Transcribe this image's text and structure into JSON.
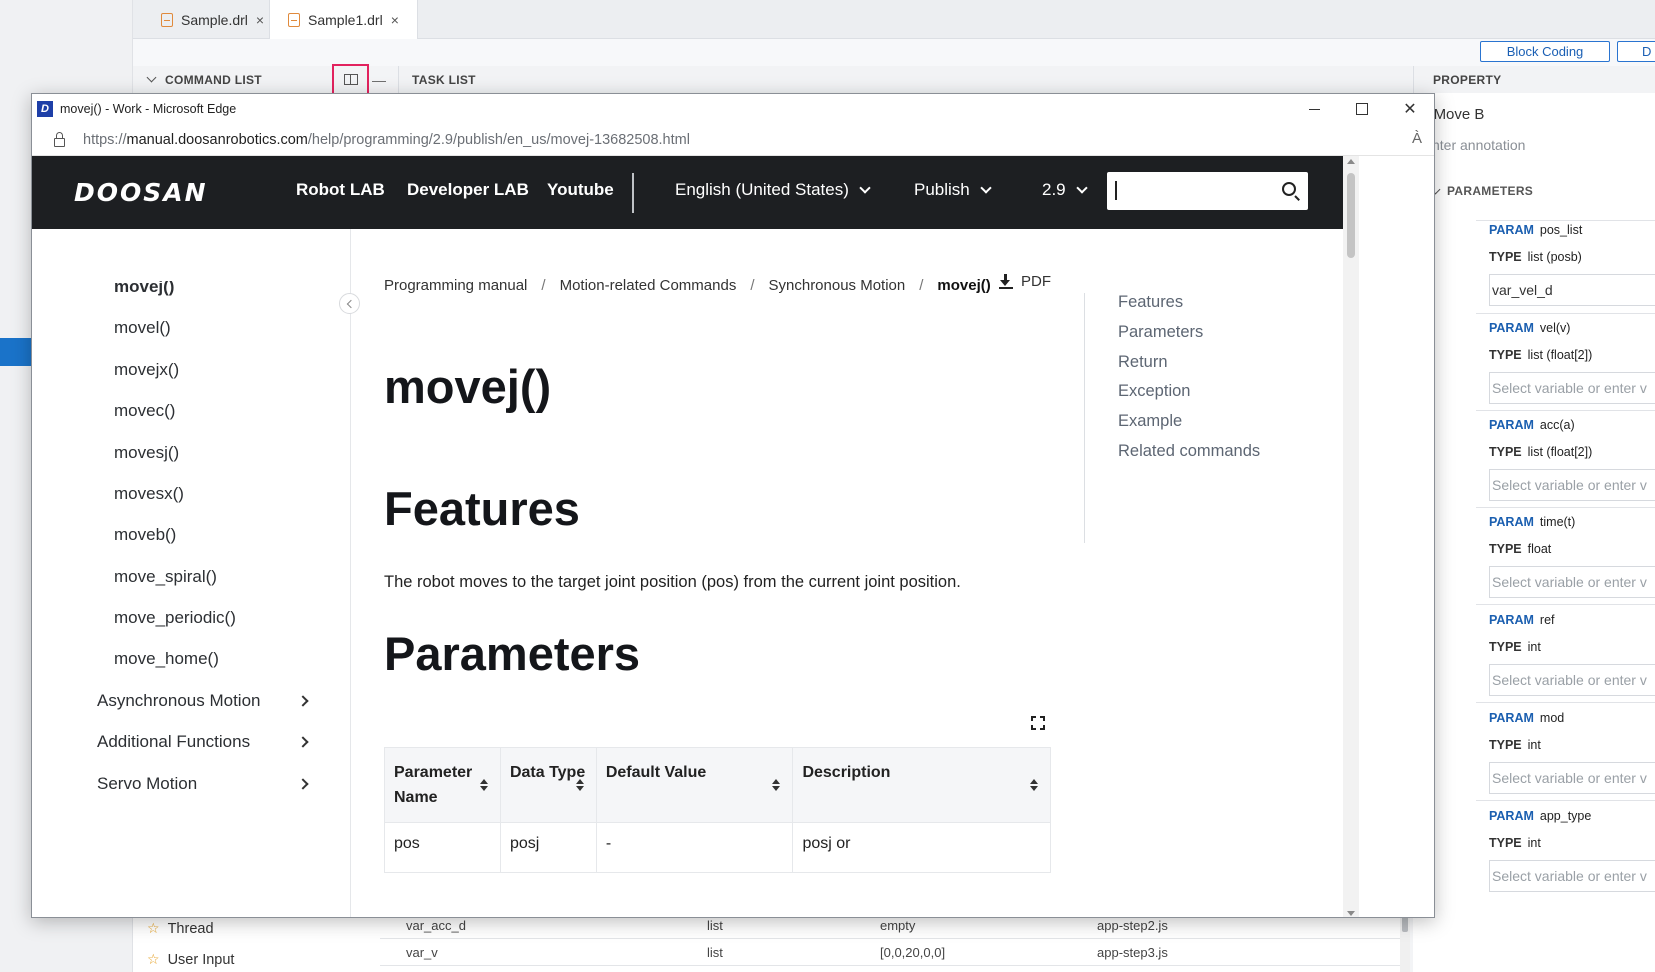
{
  "ide": {
    "tabs": [
      {
        "label": "Sample.drl",
        "close": "×"
      },
      {
        "label": "Sample1.drl",
        "close": "×"
      }
    ],
    "mode_buttons": [
      "Block Coding",
      "D"
    ],
    "command_list_label": "COMMAND LIST",
    "task_list_label": "TASK LIST",
    "property_label": "PROPERTY",
    "property_title": "Move B",
    "annotation_placeholder": "nter annotation",
    "parameters_label": "PARAMETERS",
    "param_keyword": "PARAM",
    "type_keyword": "TYPE",
    "params": [
      {
        "name": "pos_list",
        "type": "list (posb)",
        "value": "var_vel_d",
        "filled": true
      },
      {
        "name": "vel(v)",
        "type": "list (float[2])",
        "value": "Select variable or enter v"
      },
      {
        "name": "acc(a)",
        "type": "list (float[2])",
        "value": "Select variable or enter v"
      },
      {
        "name": "time(t)",
        "type": "float",
        "value": "Select variable or enter v"
      },
      {
        "name": "ref",
        "type": "int",
        "value": "Select variable or enter v"
      },
      {
        "name": "mod",
        "type": "int",
        "value": "Select variable or enter v"
      },
      {
        "name": "app_type",
        "type": "int",
        "value": "Select variable or enter v"
      }
    ],
    "commands": [
      "Thread",
      "User Input"
    ],
    "variables": [
      {
        "name": "var_acc_d",
        "type": "list",
        "value": "empty",
        "source": "app-step2.js"
      },
      {
        "name": "var_v",
        "type": "list",
        "value": "[0,0,20,0,0]",
        "source": "app-step3.js"
      }
    ]
  },
  "browser": {
    "window_title": "movej() - Work - Microsoft Edge",
    "url_prefix": "https://",
    "url_domain": "manual.doosanrobotics.com",
    "url_path": "/help/programming/2.9/publish/en_us/movej-13682508.html",
    "controls": {
      "close": "✕",
      "read_aloud": "À"
    }
  },
  "site": {
    "logo": "DOOSAN",
    "nav": [
      "Robot LAB",
      "Developer LAB",
      "Youtube"
    ],
    "language": "English (United States)",
    "publish": "Publish",
    "version": "2.9",
    "sidebar": {
      "items": [
        "movej()",
        "movel()",
        "movejx()",
        "movec()",
        "movesj()",
        "movesx()",
        "moveb()",
        "move_spiral()",
        "move_periodic()",
        "move_home()"
      ],
      "groups": [
        "Asynchronous Motion",
        "Additional Functions",
        "Servo Motion"
      ]
    },
    "breadcrumb": [
      "Programming manual",
      "Motion-related Commands",
      "Synchronous Motion",
      "movej()"
    ],
    "breadcrumb_sep": "/",
    "pdf_label": "PDF",
    "page_title": "movej()",
    "sections": {
      "features": "Features",
      "parameters": "Parameters"
    },
    "features_text": "The robot moves to the target joint position (pos) from the current joint position.",
    "table": {
      "headers": [
        "Parameter Name",
        "Data Type",
        "Default Value",
        "Description"
      ],
      "rows": [
        [
          "pos",
          "posj",
          "-",
          "posj or"
        ]
      ]
    },
    "toc": [
      "Features",
      "Parameters",
      "Return",
      "Exception",
      "Example",
      "Related commands"
    ]
  }
}
